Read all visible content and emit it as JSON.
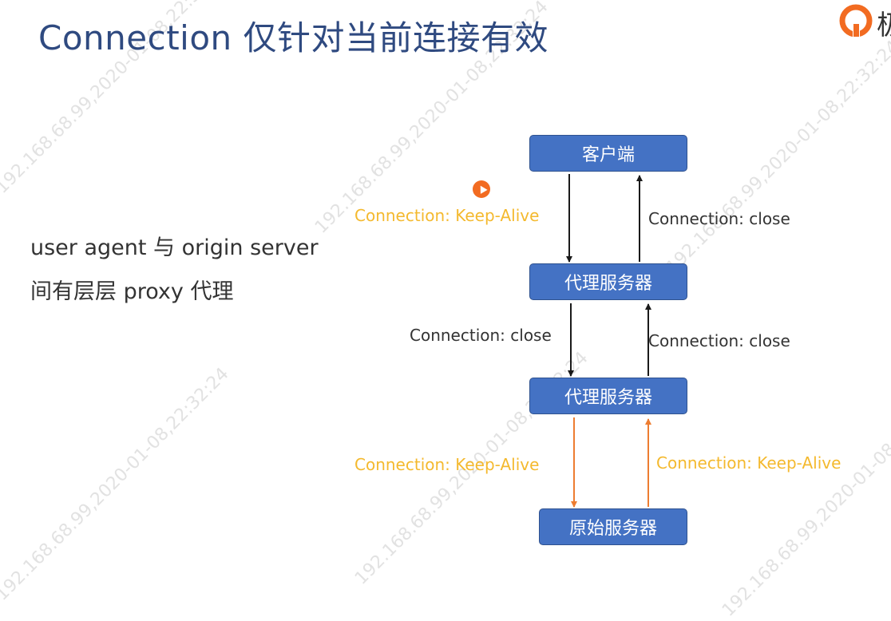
{
  "title": "Connection 仅针对当前连接有效",
  "logo": {
    "partial_text": "极"
  },
  "description": {
    "line1": "user agent 与 origin server",
    "line2": "间有层层 proxy 代理"
  },
  "nodes": {
    "client": "客户端",
    "proxy1": "代理服务器",
    "proxy2": "代理服务器",
    "origin": "原始服务器"
  },
  "edge_labels": {
    "client_to_proxy1": "Connection: Keep-Alive",
    "proxy1_to_client": "Connection: close",
    "proxy1_to_proxy2": "Connection: close",
    "proxy2_to_proxy1": "Connection: close",
    "proxy2_to_origin": "Connection: Keep-Alive",
    "origin_to_proxy2": "Connection: Keep-Alive"
  },
  "colors": {
    "node_fill": "#4472c4",
    "keep_alive": "#f4b92e",
    "arrow_orange": "#ed7d31",
    "arrow_dark": "#1a1a1a",
    "title": "#2f4a80"
  },
  "watermark": "192.168.68.99,2020-01-08,22:32:24"
}
